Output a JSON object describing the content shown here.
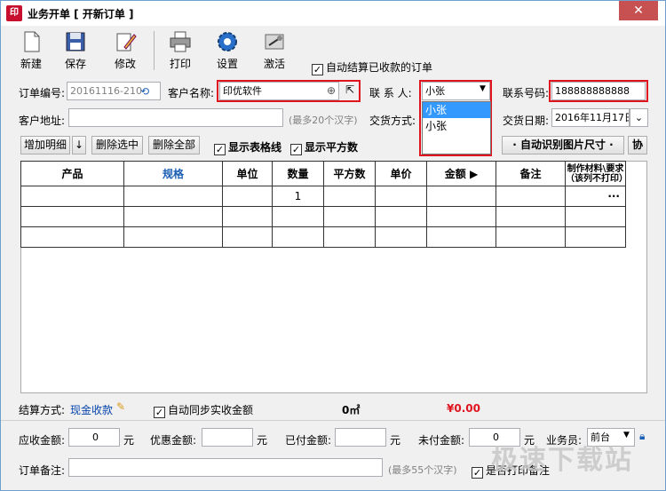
{
  "window": {
    "app_icon": "印",
    "title": "业务开单 [ 开新订单 ]",
    "close": "✕"
  },
  "toolbar": {
    "new": "新建",
    "save": "保存",
    "edit": "修改",
    "print": "打印",
    "settings": "设置",
    "activate": "激活",
    "auto_settle_label": "自动结算已收款的订单",
    "auto_settle_checked": true
  },
  "form": {
    "order_no_label": "订单编号:",
    "order_no": "20161116-210",
    "customer_name_label": "客户名称:",
    "customer_name": "印优软件",
    "contact_label": "联 系 人:",
    "contact": "小张",
    "contact_options": [
      "小张",
      "小张"
    ],
    "phone_label": "联系号码:",
    "phone": "188888888888",
    "address_label": "客户地址:",
    "address_hint": "(最多20个汉字)",
    "delivery_method_label": "交货方式:",
    "delivery_date_label": "交货日期:",
    "delivery_date": "2016年11月17日"
  },
  "grid_toolbar": {
    "add_detail": "增加明细",
    "add_arrow": "↓",
    "delete_selected": "删除选中",
    "delete_all": "删除全部",
    "show_gridlines": "显示表格线",
    "show_area": "显示平方数",
    "auto_detect": "· 自动识别图片尺寸 ·",
    "assist": "协"
  },
  "grid": {
    "columns": [
      "产品",
      "规格",
      "单位",
      "数量",
      "平方数",
      "单价",
      "金额 ▶",
      "备注",
      "制作材料\\要求（该列不打印）"
    ],
    "rows": [
      [
        "",
        "",
        "",
        "1",
        "",
        "",
        "",
        "",
        "···"
      ],
      [
        "",
        "",
        "",
        "",
        "",
        "",
        "",
        "",
        ""
      ],
      [
        "",
        "",
        "",
        "",
        "",
        "",
        "",
        "",
        ""
      ]
    ]
  },
  "summary": {
    "settle_label": "结算方式:",
    "settle_value": "现金收款",
    "auto_sync_label": "自动同步实收金额",
    "area_total": "0㎡",
    "amount_total": "¥0.00"
  },
  "totals": {
    "receivable_label": "应收金额:",
    "receivable": "0",
    "unit": "元",
    "discount_label": "优惠金额:",
    "paid_label": "已付金额:",
    "unpaid_label": "未付金额:",
    "unpaid": "0",
    "salesman_label": "业务员:",
    "salesman": "前台"
  },
  "notes": {
    "label": "订单备注:",
    "hint": "(最多55个汉字)",
    "print_checkbox_label": "是否打印备注"
  },
  "watermark": "极速下载站",
  "colors": {
    "highlight_red": "#e0141e",
    "selection_blue": "#3399ff",
    "amount_red": "#e0141e",
    "link_blue": "#0645ad"
  }
}
